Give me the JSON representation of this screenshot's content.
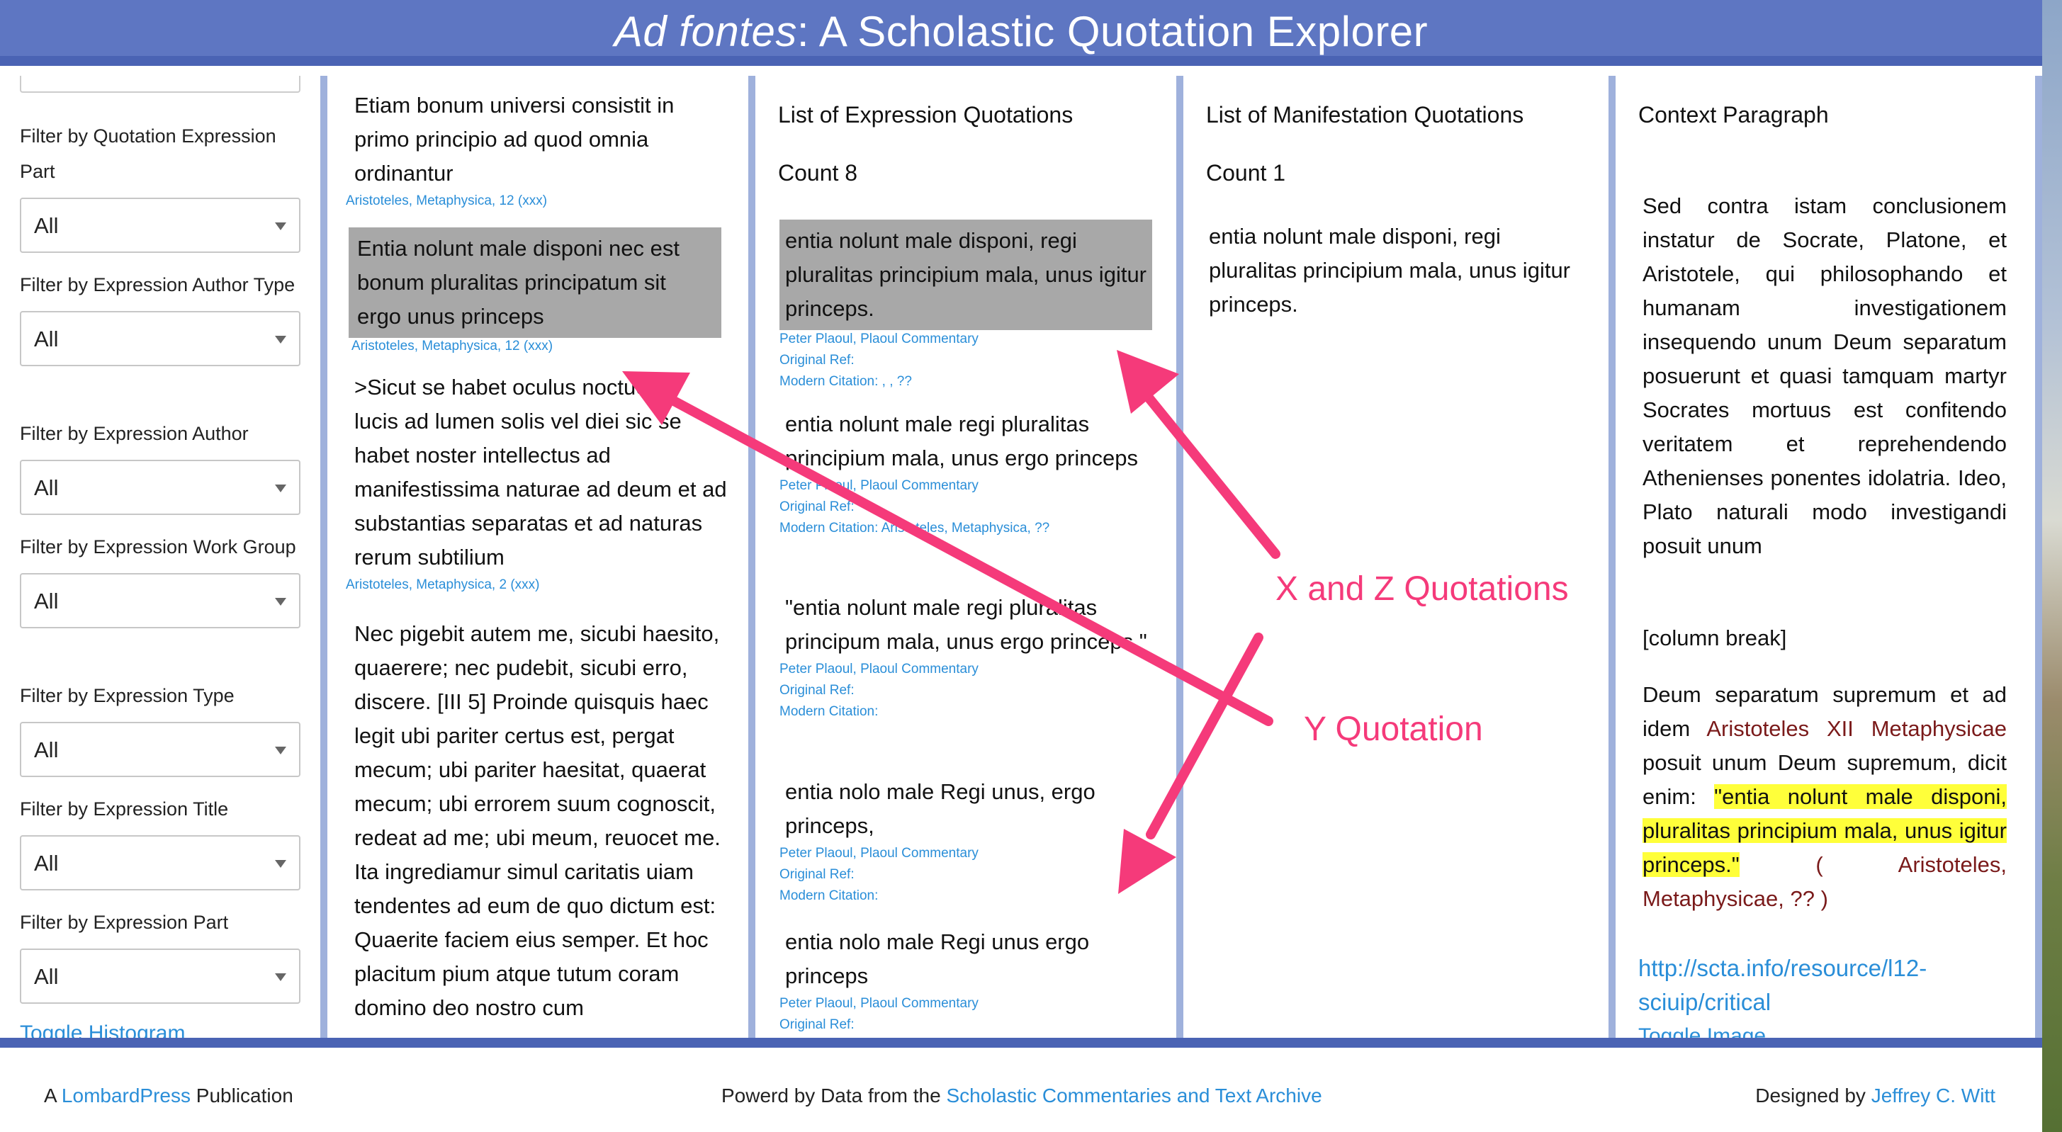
{
  "header": {
    "title_italic": "Ad fontes",
    "title_rest": ": A Scholastic Quotation Explorer"
  },
  "filters": [
    {
      "label": "Filter by Quotation Expression Part",
      "value": "All"
    },
    {
      "label": "Filter by Expression Author Type",
      "value": "All"
    },
    {
      "label": "Filter by Expression Author",
      "value": "All"
    },
    {
      "label": "Filter by Expression Work Group",
      "value": "All"
    },
    {
      "label": "Filter by Expression Type",
      "value": "All"
    },
    {
      "label": "Filter by Expression Title",
      "value": "All"
    },
    {
      "label": "Filter by Expression Part",
      "value": "All"
    }
  ],
  "toggle_histogram": "Toggle Histogram",
  "quotations": [
    {
      "text": "Etiam bonum universi consistit in primo principio ad quod omnia ordinantur",
      "cite": "Aristoteles, Metaphysica, 12 (xxx)"
    },
    {
      "text": "Entia nolunt male disponi nec est bonum pluralitas principatum sit ergo unus princeps",
      "cite": "Aristoteles, Metaphysica, 12 (xxx)"
    },
    {
      "text": ">Sicut se habet oculus noctue ad lucis ad lumen solis vel diei sic se habet noster intellectus ad manifestissima naturae ad deum et ad substantias separatas et ad naturas rerum subtilium",
      "cite": "Aristoteles, Metaphysica, 2 (xxx)"
    },
    {
      "text": "Nec pigebit autem me, sicubi haesito, quaerere; nec pudebit, sicubi erro, discere. [III 5] Proinde quisquis haec legit ubi pariter certus est, pergat mecum; ubi pariter haesitat, quaerat mecum; ubi errorem suum cognoscit, redeat ad me; ubi meum, reuocet me. Ita ingrediamur simul caritatis uiam tendentes ad eum de quo dictum est: Quaerite faciem eius semper. Et hoc placitum pium atque tutum coram domino deo nostro cum"
    }
  ],
  "expressions": {
    "heading": "List of Expression Quotations",
    "count": "Count 8",
    "items": [
      {
        "text": "entia nolunt male disponi, regi pluralitas principium mala, unus igitur princeps.",
        "author": "Peter Plaoul, Plaoul Commentary",
        "ref": "Original Ref:",
        "modern": "Modern Citation: , , ??"
      },
      {
        "text": "entia nolunt male regi pluralitas principium mala, unus ergo princeps",
        "author": "Peter Plaoul, Plaoul Commentary",
        "ref": "Original Ref:",
        "modern": "Modern Citation: Aristoteles, Metaphysica, ??"
      },
      {
        "text": "\"entia nolunt male regi pluralitas principum mala, unus ergo princeps.\"",
        "author": "Peter Plaoul, Plaoul Commentary",
        "ref": "Original Ref:",
        "modern": "Modern Citation:"
      },
      {
        "text": "entia nolo male Regi unus, ergo princeps,",
        "author": "Peter Plaoul, Plaoul Commentary",
        "ref": "Original Ref:",
        "modern": "Modern Citation:"
      },
      {
        "text": "entia nolo male Regi unus ergo princeps",
        "author": "Peter Plaoul, Plaoul Commentary",
        "ref": "Original Ref:",
        "modern": ""
      }
    ]
  },
  "manifestations": {
    "heading": "List of Manifestation Quotations",
    "count": "Count 1",
    "items": [
      {
        "text": "entia nolunt male disponi, regi pluralitas principium mala, unus igitur princeps."
      }
    ]
  },
  "context": {
    "heading": "Context Paragraph",
    "para1": "Sed contra istam conclusionem instatur de Socrate, Platone, et Aristotele, qui philosophando et humanam investigationem insequendo unum Deum separatum posuerunt et quasi tamquam martyr Socrates mortuus est confitendo veritatem et reprehendendo Athenienses ponentes idolatria. Ideo, Plato naturali modo investigandi posuit unum",
    "para2": "[column break]",
    "para3_a": "Deum separatum supremum et ad idem ",
    "para3_ref": "Aristoteles XII Metaphysicae",
    "para3_b": " posuit unum Deum supremum, dicit enim: ",
    "para3_hl": "\"entia nolunt male disponi, pluralitas principium mala, unus igitur princeps.\"",
    "para3_cite": " ( Aristoteles, Metaphysicae, ?? )",
    "link": "http://scta.info/resource/l12-sciuip/critical",
    "toggle_image": "Toggle Image"
  },
  "annotations": {
    "label_xz": "X and Z Quotations",
    "label_y": "Y Quotation",
    "color": "#f53a7a"
  },
  "footer": {
    "left_prefix": "A ",
    "left_link": "LombardPress",
    "left_suffix": " Publication",
    "mid_prefix": "Powerd by Data from the ",
    "mid_link": "Scholastic Commentaries and Text Archive",
    "right_prefix": "Designed by ",
    "right_link": "Jeffrey C. Witt"
  }
}
